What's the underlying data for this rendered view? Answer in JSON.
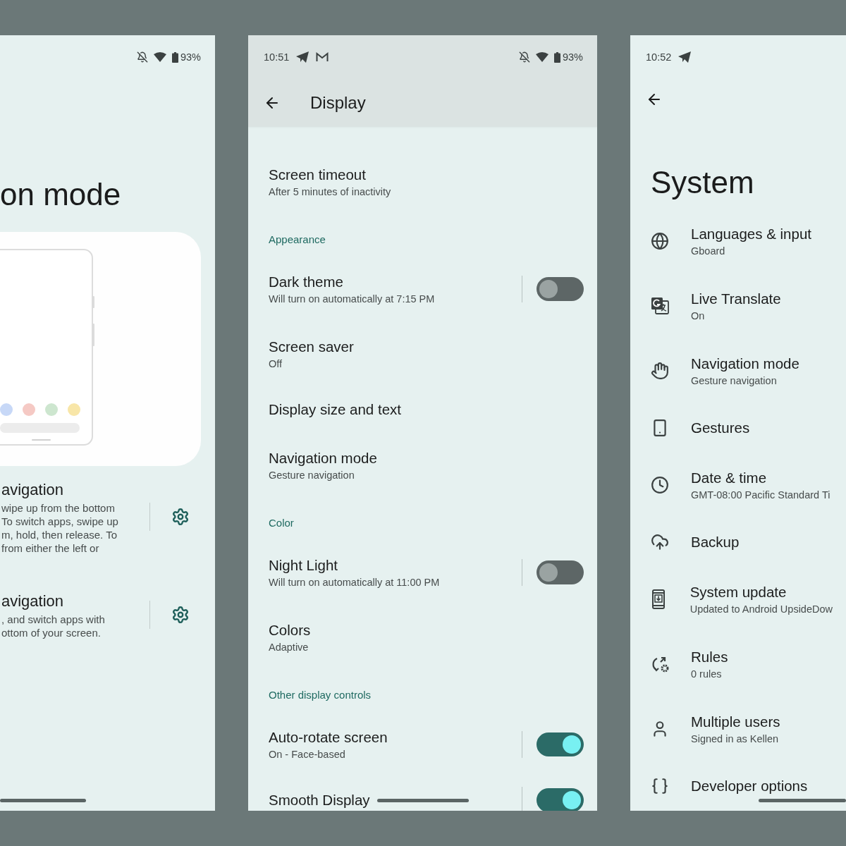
{
  "left_screen": {
    "status_bar": {
      "battery": "93%"
    },
    "title": "on mode",
    "options": [
      {
        "title": "avigation",
        "lines": [
          "wipe up from the bottom",
          "To switch apps, swipe up",
          "m, hold, then release. To",
          "from either the left or"
        ]
      },
      {
        "title": "avigation",
        "lines": [
          ", and switch apps with",
          "ottom of your screen."
        ]
      }
    ]
  },
  "middle_screen": {
    "status_bar": {
      "time": "10:51",
      "battery": "93%"
    },
    "title": "Display",
    "items": [
      {
        "kind": "item",
        "title": "Screen timeout",
        "subtitle": "After 5 minutes of inactivity"
      },
      {
        "kind": "section",
        "title": "Appearance"
      },
      {
        "kind": "toggle",
        "title": "Dark theme",
        "subtitle": "Will turn on automatically at 7:15 PM",
        "on": false
      },
      {
        "kind": "item",
        "title": "Screen saver",
        "subtitle": "Off"
      },
      {
        "kind": "item",
        "title": "Display size and text"
      },
      {
        "kind": "item",
        "title": "Navigation mode",
        "subtitle": "Gesture navigation"
      },
      {
        "kind": "section",
        "title": "Color"
      },
      {
        "kind": "toggle",
        "title": "Night Light",
        "subtitle": "Will turn on automatically at 11:00 PM",
        "on": false
      },
      {
        "kind": "item",
        "title": "Colors",
        "subtitle": "Adaptive"
      },
      {
        "kind": "section",
        "title": "Other display controls"
      },
      {
        "kind": "toggle",
        "title": "Auto-rotate screen",
        "subtitle": "On - Face-based",
        "on": true
      },
      {
        "kind": "toggle",
        "title": "Smooth Display",
        "on": true
      }
    ]
  },
  "right_screen": {
    "status_bar": {
      "time": "10:52"
    },
    "title": "System",
    "items": [
      {
        "title": "Languages & input",
        "subtitle": "Gboard"
      },
      {
        "title": "Live Translate",
        "subtitle": "On"
      },
      {
        "title": "Navigation mode",
        "subtitle": "Gesture navigation"
      },
      {
        "title": "Gestures"
      },
      {
        "title": "Date & time",
        "subtitle": "GMT-08:00 Pacific Standard Ti"
      },
      {
        "title": "Backup"
      },
      {
        "title": "System update",
        "subtitle": "Updated to Android UpsideDow"
      },
      {
        "title": "Rules",
        "subtitle": "0 rules"
      },
      {
        "title": "Multiple users",
        "subtitle": "Signed in as Kellen"
      },
      {
        "title": "Developer options"
      }
    ]
  }
}
